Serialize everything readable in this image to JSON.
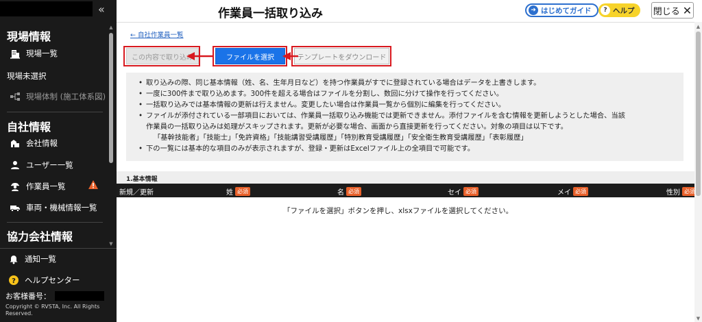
{
  "sidebar": {
    "collapse_glyph": "«",
    "section_site": "現場情報",
    "item_site_list": "現場一覧",
    "site_unselected": "現場未選択",
    "item_site_structure": "現場体制 (施工体系図)",
    "section_company": "自社情報",
    "item_company_info": "会社情報",
    "item_user_list": "ユーザー一覧",
    "item_worker_list": "作業員一覧",
    "item_vehicle_list": "車両・機械情報一覧",
    "section_partner": "協力会社情報",
    "item_notifications": "通知一覧",
    "item_help_center": "ヘルプセンター",
    "customer_label": "お客様番号：",
    "copyright": "Copyright © RVSTA, Inc. All Rights Reserved."
  },
  "header": {
    "title": "作業員一括取り込み",
    "guide_label": "はじめてガイド",
    "help_label": "ヘルプ",
    "close_label": "閉じる"
  },
  "main": {
    "back_link": "自社作業員一覧",
    "import_button": "この内容で取り込み",
    "select_file_button": "ファイルを選択",
    "template_download_button": "テンプレートをダウンロード",
    "notes": [
      "取り込みの際、同じ基本情報（姓、名、生年月日など）を持つ作業員がすでに登録されている場合はデータを上書きします。",
      "一度に300件まで取り込めます。300件を超える場合はファイルを分割し、数回に分けて操作を行ってください。",
      "一括取り込みでは基本情報の更新は行えません。変更したい場合は作業員一覧から個別に編集を行ってください。",
      "ファイルが添付されている一部項目においては、作業員一括取り込み機能では更新できません。添付ファイルを含む情報を更新しようとした場合、当該",
      "作業員の一括取り込みは処理がスキップされます。更新が必要な場合、画面から直接更新を行ってください。対象の項目は以下です。",
      "「基幹技能者」「技能士」「免許資格」「技能講習受講履歴」「特別教育受講履歴」「安全衛生教育受講履歴」「表彰履歴」",
      "下の一覧には基本的な項目のみが表示されますが、登録・更新はExcelファイル上の全項目で可能です。"
    ],
    "section_title": "1.基本情報",
    "columns": {
      "new_update": "新規／更新",
      "last_name": "姓",
      "first_name": "名",
      "last_name_kana": "セイ",
      "first_name_kana": "メイ",
      "gender": "性別",
      "required": "必須"
    },
    "empty_message": "「ファイルを選択」ボタンを押し、xlsxファイルを選択してください。"
  },
  "colors": {
    "sidebar_bg": "#1a1a1a",
    "primary_button": "#1a73e8",
    "annotation_red": "#d8181e",
    "required_badge": "#e8602a",
    "help_yellow": "#f7d32a",
    "warning_orange": "#e8602a"
  },
  "icons": {
    "site_list": "building-icon",
    "site_structure": "hierarchy-icon",
    "company_info": "company-icon",
    "user_list": "user-icon",
    "worker_list": "worker-icon",
    "vehicle_list": "truck-icon",
    "notifications": "bell-icon",
    "help_center": "help-circle-icon",
    "warning": "warning-icon"
  }
}
